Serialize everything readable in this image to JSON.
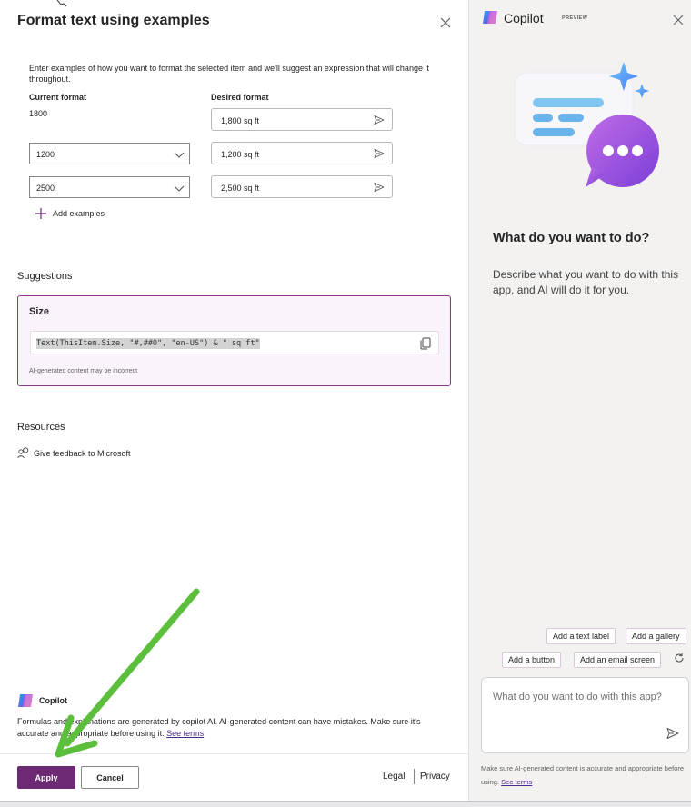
{
  "dialog": {
    "title": "Format text using examples",
    "intro": "Enter examples of how you want to format the selected item and we'll suggest an expression that will change it throughout.",
    "current_format_label": "Current format",
    "desired_format_label": "Desired format",
    "current_value": "1800",
    "rows": [
      {
        "current": "1200",
        "desired": "1,200 sq ft"
      },
      {
        "current": "2500",
        "desired": "2,500 sq ft"
      }
    ],
    "first_desired": "1,800 sq ft",
    "add_examples": "Add examples",
    "suggestions_heading": "Suggestions",
    "suggestion": {
      "title": "Size",
      "code": "Text(ThisItem.Size, \"#,##0\", \"en-US\") & \" sq ft\"",
      "note": "AI-generated content may be incorrect"
    },
    "resources_heading": "Resources",
    "feedback": "Give feedback to Microsoft",
    "footer_brand": "Copilot",
    "disclaimer": "Formulas and explanations are generated by copilot AI. AI-generated content can have mistakes. Make sure it's accurate and appropriate before using it.",
    "see_terms": "See terms",
    "apply": "Apply",
    "cancel": "Cancel",
    "legal": "Legal",
    "privacy": "Privacy"
  },
  "copilot": {
    "title": "Copilot",
    "badge": "PREVIEW",
    "question": "What do you want to do?",
    "description": "Describe what you want to do with this app, and AI will do it for you.",
    "chips": [
      "Add a text label",
      "Add a gallery",
      "Add a button",
      "Add an email screen"
    ],
    "input_placeholder": "What do you want to do with this app?",
    "note": "Make sure AI-generated content is accurate and appropriate before using.",
    "see_terms": "See terms"
  },
  "colors": {
    "accent": "#6b2a73",
    "suggestion_border": "#8b3a8f",
    "arrow": "#5cbf3c"
  }
}
